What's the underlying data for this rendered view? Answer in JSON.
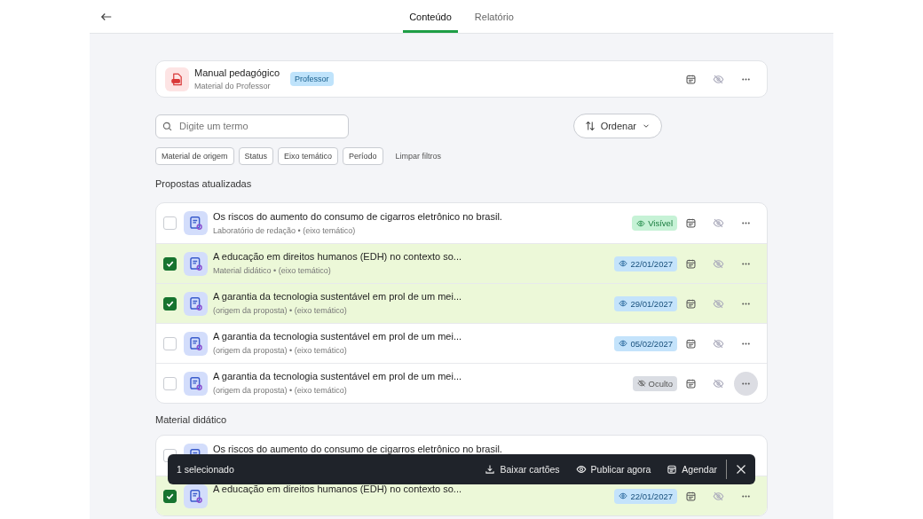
{
  "tabs": [
    {
      "label": "Conteúdo",
      "selected": true
    },
    {
      "label": "Relatório",
      "selected": false
    }
  ],
  "material": {
    "title": "Manual pedagógico",
    "subtitle": "Material do Professor",
    "badge": "Professor"
  },
  "search": {
    "placeholder": "Digite um termo"
  },
  "sort": {
    "label": "Ordenar"
  },
  "filters": [
    "Material de origem",
    "Status",
    "Eixo temático",
    "Período"
  ],
  "clear_filters": "Limpar filtros",
  "sections": [
    {
      "title": "Propostas atualizadas",
      "rows": [
        {
          "checked": false,
          "title": "Os riscos do aumento do consumo de cigarros eletrônico no brasil.",
          "meta": "Laboratório de redação • (eixo temático)",
          "status": {
            "kind": "visible",
            "label": "Visível"
          },
          "hovered": false
        },
        {
          "checked": true,
          "title": "A educação em direitos humanos (EDH) no contexto so...",
          "meta": "Material didático • (eixo temático)",
          "status": {
            "kind": "scheduled",
            "label": "22/01/2027"
          },
          "hovered": false
        },
        {
          "checked": true,
          "title": "A garantia da tecnologia sustentável em prol de um mei...",
          "meta": "(origem da proposta) • (eixo temático)",
          "status": {
            "kind": "scheduled",
            "label": "29/01/2027"
          },
          "hovered": false
        },
        {
          "checked": false,
          "title": "A garantia da tecnologia sustentável em prol de um mei...",
          "meta": "(origem da proposta) • (eixo temático)",
          "status": {
            "kind": "scheduled",
            "label": "05/02/2027"
          },
          "hovered": false
        },
        {
          "checked": false,
          "title": "A garantia da tecnologia sustentável em prol de um mei...",
          "meta": "(origem da proposta) • (eixo temático)",
          "status": {
            "kind": "hidden",
            "label": "Oculto"
          },
          "hovered": true
        }
      ]
    },
    {
      "title": "Material didático",
      "rows": [
        {
          "checked": false,
          "title": "Os riscos do aumento do consumo de cigarros eletrônico no brasil."
        },
        {
          "checked": true,
          "title": "A educação em direitos humanos (EDH) no contexto so...",
          "status": {
            "kind": "scheduled",
            "label": "22/01/2027"
          },
          "hovered": false
        }
      ]
    }
  ],
  "selection_bar": {
    "count": "1 selecionado",
    "actions": [
      {
        "kind": "download",
        "label": "Baixar cartões"
      },
      {
        "kind": "publish",
        "label": "Publicar agora"
      },
      {
        "kind": "schedule",
        "label": "Agendar"
      }
    ]
  }
}
